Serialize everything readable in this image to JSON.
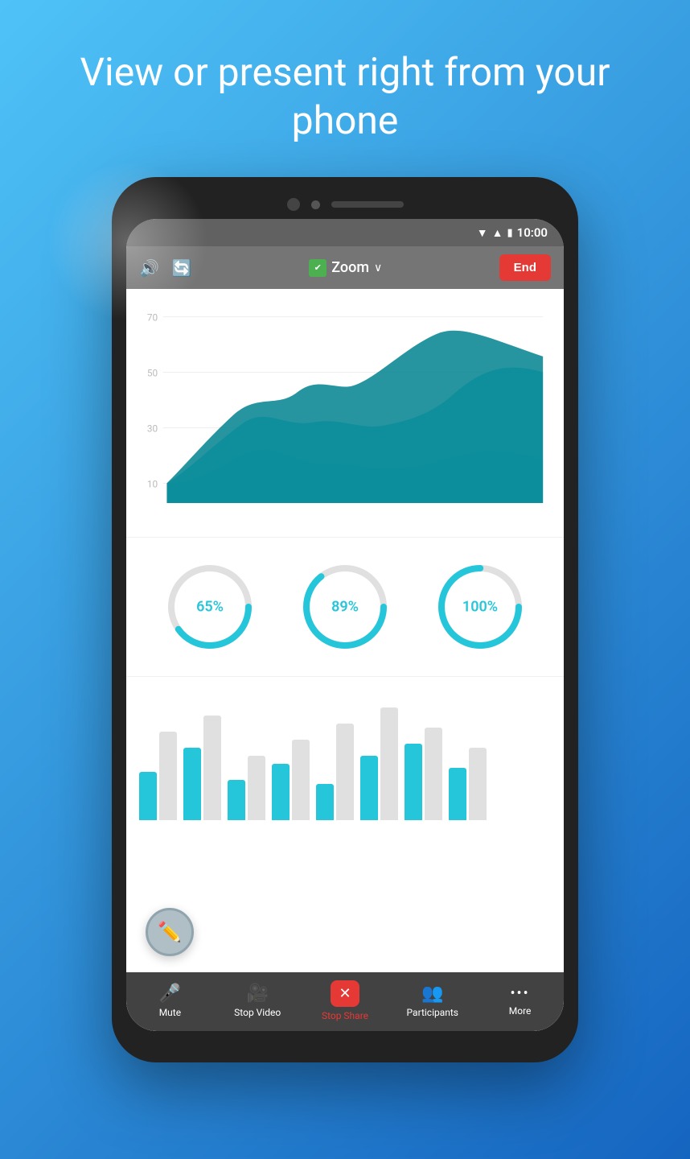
{
  "hero": {
    "title": "View or present right from your phone"
  },
  "status_bar": {
    "time": "10:00"
  },
  "toolbar": {
    "zoom_label": "Zoom",
    "end_label": "End"
  },
  "chart": {
    "y_labels": [
      "70",
      "50",
      "30",
      "10"
    ],
    "series_colors": [
      "#00838f",
      "#26c6da",
      "#80deea"
    ]
  },
  "donuts": [
    {
      "value": "65%",
      "percent": 65
    },
    {
      "value": "89%",
      "percent": 89
    },
    {
      "value": "100%",
      "percent": 100
    }
  ],
  "bars": [
    {
      "teal": 60,
      "gray": 110
    },
    {
      "teal": 90,
      "gray": 130
    },
    {
      "teal": 50,
      "gray": 80
    },
    {
      "teal": 70,
      "gray": 100
    },
    {
      "teal": 45,
      "gray": 120
    },
    {
      "teal": 80,
      "gray": 140
    },
    {
      "teal": 95,
      "gray": 115
    },
    {
      "teal": 65,
      "gray": 90
    }
  ],
  "nav": {
    "items": [
      {
        "id": "mute",
        "label": "Mute",
        "icon": "🎤"
      },
      {
        "id": "stop-video",
        "label": "Stop Video",
        "icon": "🎥"
      },
      {
        "id": "stop-share",
        "label": "Stop Share",
        "icon": "✕"
      },
      {
        "id": "participants",
        "label": "Participants",
        "icon": "👥"
      },
      {
        "id": "more",
        "label": "More",
        "icon": "···"
      }
    ]
  }
}
